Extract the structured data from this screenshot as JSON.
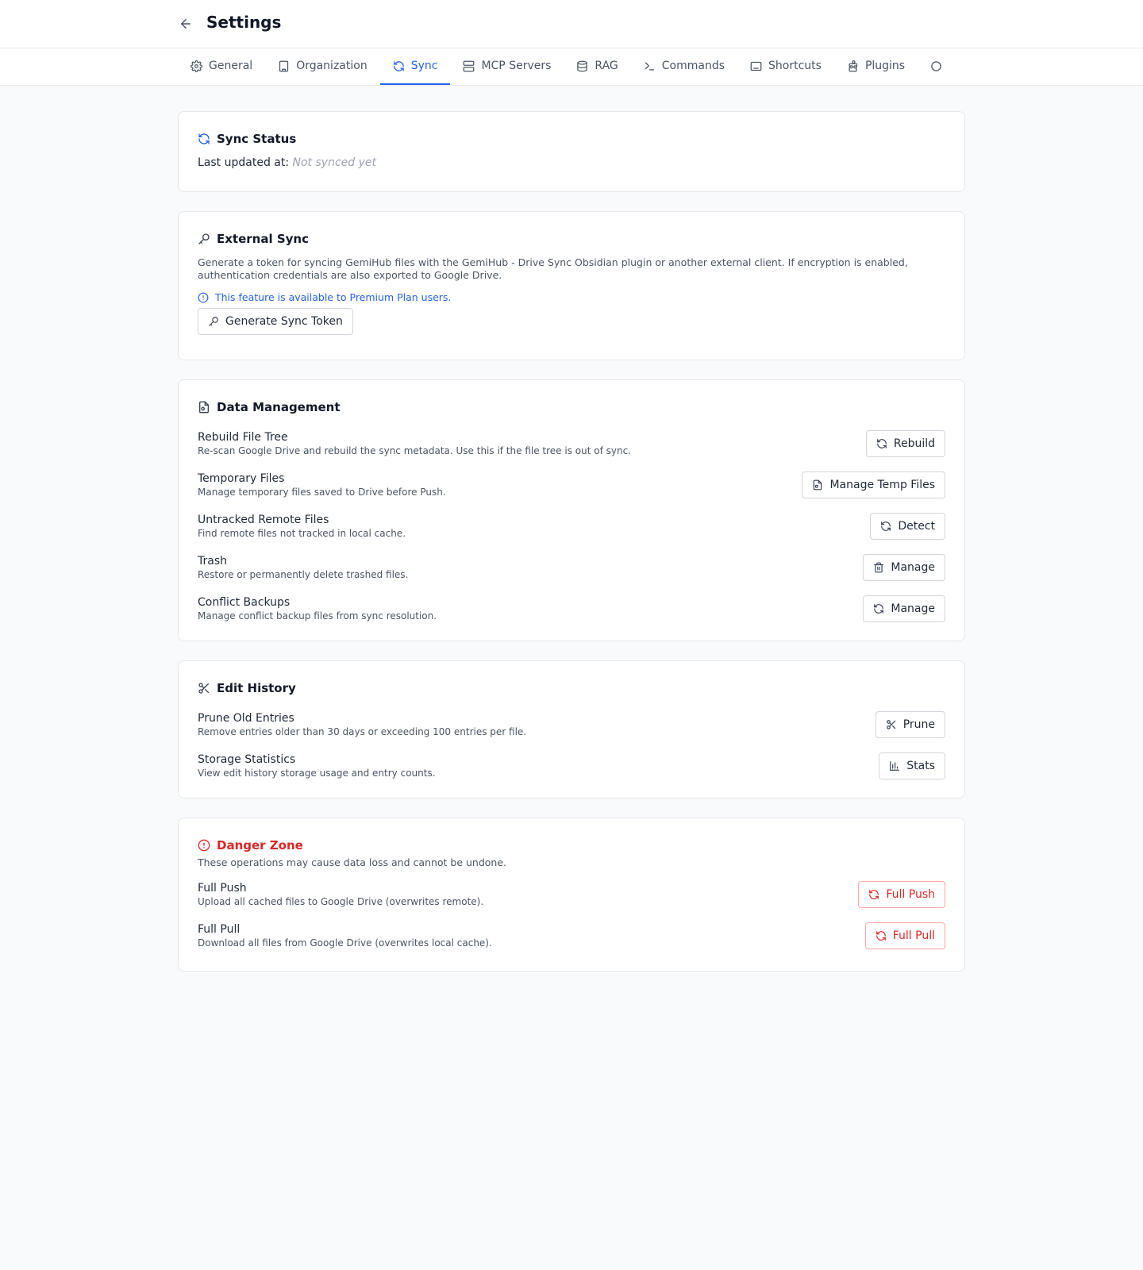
{
  "header": {
    "back_icon": "arrow-left-icon",
    "title": "Settings"
  },
  "tabs": [
    {
      "label": "General",
      "icon": "gear-icon",
      "active": false
    },
    {
      "label": "Organization",
      "icon": "building-icon",
      "active": false
    },
    {
      "label": "Sync",
      "icon": "refresh-icon",
      "active": true
    },
    {
      "label": "MCP Servers",
      "icon": "server-icon",
      "active": false
    },
    {
      "label": "RAG",
      "icon": "database-icon",
      "active": false
    },
    {
      "label": "Commands",
      "icon": "terminal-icon",
      "active": false
    },
    {
      "label": "Shortcuts",
      "icon": "keyboard-icon",
      "active": false
    },
    {
      "label": "Plugins",
      "icon": "puzzle-icon",
      "active": false
    },
    {
      "label": "",
      "icon": "partial-icon",
      "active": false
    }
  ],
  "sync_status": {
    "title": "Sync Status",
    "last_updated_label": "Last updated at:",
    "last_updated_value": "Not synced yet"
  },
  "external_sync": {
    "title": "External Sync",
    "description": "Generate a token for syncing GemiHub files with the GemiHub - Drive Sync Obsidian plugin or another external client. If encryption is enabled, authentication credentials are also exported to Google Drive.",
    "premium_note": "This feature is available to Premium Plan users.",
    "button_label": "Generate Sync Token"
  },
  "data_management": {
    "title": "Data Management",
    "rows": [
      {
        "label": "Rebuild File Tree",
        "desc": "Re-scan Google Drive and rebuild the sync metadata. Use this if the file tree is out of sync.",
        "button": "Rebuild",
        "icon": "refresh-icon"
      },
      {
        "label": "Temporary Files",
        "desc": "Manage temporary files saved to Drive before Push.",
        "button": "Manage Temp Files",
        "icon": "file-icon"
      },
      {
        "label": "Untracked Remote Files",
        "desc": "Find remote files not tracked in local cache.",
        "button": "Detect",
        "icon": "refresh-icon"
      },
      {
        "label": "Trash",
        "desc": "Restore or permanently delete trashed files.",
        "button": "Manage",
        "icon": "trash-icon"
      },
      {
        "label": "Conflict Backups",
        "desc": "Manage conflict backup files from sync resolution.",
        "button": "Manage",
        "icon": "refresh-icon"
      }
    ]
  },
  "edit_history": {
    "title": "Edit History",
    "rows": [
      {
        "label": "Prune Old Entries",
        "desc": "Remove entries older than 30 days or exceeding 100 entries per file.",
        "button": "Prune",
        "icon": "scissors-icon"
      },
      {
        "label": "Storage Statistics",
        "desc": "View edit history storage usage and entry counts.",
        "button": "Stats",
        "icon": "bar-chart-icon"
      }
    ]
  },
  "danger_zone": {
    "title": "Danger Zone",
    "description": "These operations may cause data loss and cannot be undone.",
    "rows": [
      {
        "label": "Full Push",
        "desc": "Upload all cached files to Google Drive (overwrites remote).",
        "button": "Full Push",
        "icon": "refresh-icon"
      },
      {
        "label": "Full Pull",
        "desc": "Download all files from Google Drive (overwrites local cache).",
        "button": "Full Pull",
        "icon": "refresh-icon"
      }
    ]
  },
  "colors": {
    "accent": "#2563eb",
    "danger": "#dc2626",
    "border": "#e5e7eb",
    "background": "#f9fafb"
  }
}
